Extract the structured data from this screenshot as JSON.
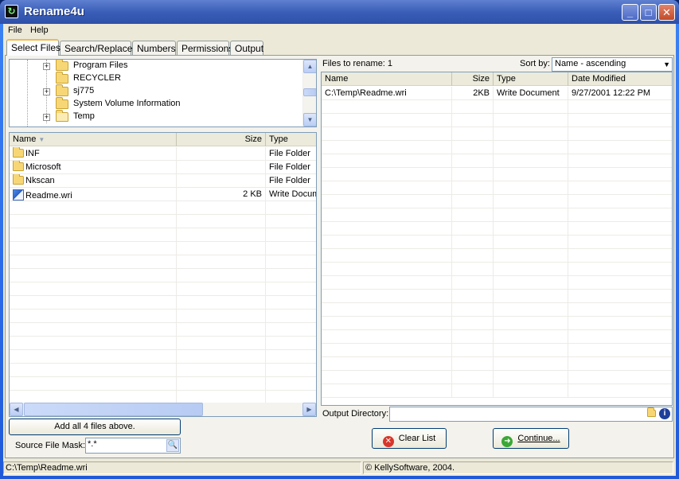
{
  "window": {
    "title": "Rename4u",
    "minimize_label": "_",
    "maximize_label": "□",
    "close_label": "✕"
  },
  "menu": {
    "file": "File",
    "help": "Help"
  },
  "tabs": [
    {
      "label": "Select Files",
      "active": true
    },
    {
      "label": "Search/Replace"
    },
    {
      "label": "Numbers"
    },
    {
      "label": "Permissions"
    },
    {
      "label": "Output"
    }
  ],
  "tree": {
    "items": [
      {
        "label": "Program Files",
        "expandable": true
      },
      {
        "label": "RECYCLER",
        "expandable": false
      },
      {
        "label": "sj775",
        "expandable": true
      },
      {
        "label": "System Volume Information",
        "expandable": false
      },
      {
        "label": "Temp",
        "expandable": true,
        "open": true
      }
    ]
  },
  "left_list": {
    "columns": {
      "name": "Name",
      "size": "Size",
      "type": "Type"
    },
    "sort_indicator": "▼",
    "rows": [
      {
        "name": "INF",
        "size": "",
        "type": "File Folder",
        "icon": "folder-icon"
      },
      {
        "name": "Microsoft",
        "size": "",
        "type": "File Folder",
        "icon": "folder-icon"
      },
      {
        "name": "Nkscan",
        "size": "",
        "type": "File Folder",
        "icon": "folder-icon"
      },
      {
        "name": "Readme.wri",
        "size": "2 KB",
        "type": "Write Document",
        "icon": "write-document-icon"
      }
    ]
  },
  "add_all_button": "Add all 4 files above.",
  "source_mask": {
    "label": "Source File Mask:",
    "value": "*.*"
  },
  "right": {
    "files_to_rename": "Files to rename: 1",
    "sort_by_label": "Sort by:",
    "sort_by_value": "Name - ascending",
    "columns": {
      "name": "Name",
      "size": "Size",
      "type": "Type",
      "date": "Date Modified"
    },
    "rows": [
      {
        "name": "C:\\Temp\\Readme.wri",
        "size": "2KB",
        "type": "Write Document",
        "date": "9/27/2001 12:22 PM"
      }
    ],
    "output_directory_label": "Output Directory:",
    "output_directory_value": "",
    "clear_list_button": "Clear List",
    "continue_button": "Continue..."
  },
  "status": {
    "path": "C:\\Temp\\Readme.wri",
    "copyright": "© KellySoftware, 2004."
  },
  "colors": {
    "accent_tab": "#f6b84a",
    "selection_border": "#7f9db9",
    "clear_icon": "#d8362a",
    "continue_icon": "#3aa836"
  }
}
